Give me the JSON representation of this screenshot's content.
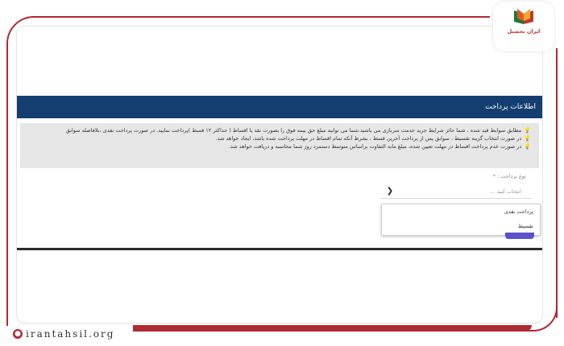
{
  "logo": {
    "text": "ایران تحصیل"
  },
  "section": {
    "title": "اطلاعات پرداخت"
  },
  "info": {
    "lines": [
      "مطابق سوابط قید شده ، شما حائز شرایط جرید خدمت سربازی می باشید.شما می توانید مبلغ حق بیمه فوق را بصورت نقد یا اقساط ( حداکثر ۱۲ قسط )پرداخت نمایید. در صورت پرداخت نقدی ،بلافاصله سوابق",
      "در صورت انتخاب گزینه تقسیط ، سوابق پس از پرداخت آخرین قسط ، بشرط آنکه تمام اقساط در مهلت پرداخت شده باشد، ایجاد خواهد شد.",
      "در صورت عدم پرداخت اقساط در مهلت تعیین شده، مبلغ مابه التفاوت براساس متوسط دستمزد روز شما محاسبه و دریافت خواهد شد."
    ]
  },
  "payment_type": {
    "label": "نوع پرداخت : *",
    "placeholder": "انتخاب کنید ...",
    "options": [
      "پرداخت نقدی",
      "تقسیط"
    ]
  },
  "watermark": {
    "text": "irantahsil.org"
  },
  "colors": {
    "header": "#143e70",
    "accent": "#b02a33",
    "submit": "#5c52c8"
  }
}
